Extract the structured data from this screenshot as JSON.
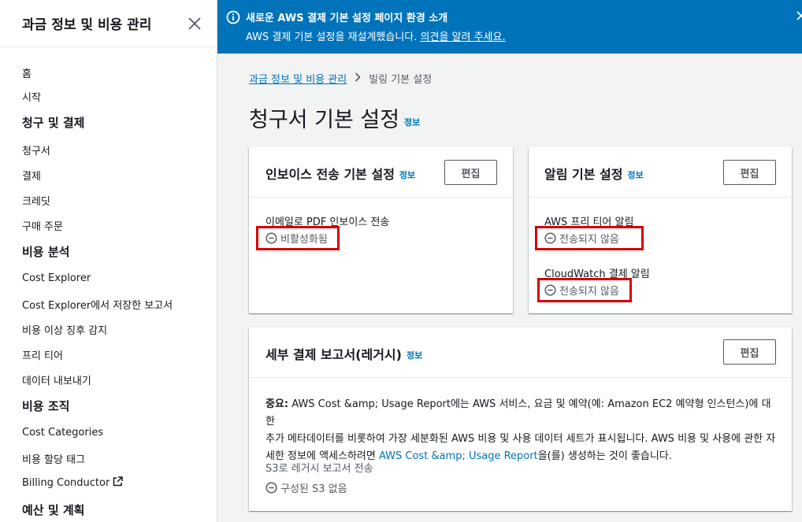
{
  "sidebar": {
    "title": "과금 정보 및 비용 관리",
    "items": [
      {
        "label": "홈"
      },
      {
        "label": "시작"
      },
      {
        "label": "청구 및 결제"
      },
      {
        "label": "청구서"
      },
      {
        "label": "결제"
      },
      {
        "label": "크레딧"
      },
      {
        "label": "구매 주문"
      },
      {
        "label": "비용 분석"
      },
      {
        "label": "Cost Explorer"
      },
      {
        "label": "Cost Explorer에서 저장한 보고서"
      },
      {
        "label": "비용 이상 징후 감지"
      },
      {
        "label": "프리 티어"
      },
      {
        "label": "데이터 내보내기"
      },
      {
        "label": "비용 조직"
      },
      {
        "label": "Cost Categories"
      },
      {
        "label": "비용 할당 태그"
      },
      {
        "label": "Billing Conductor"
      },
      {
        "label": "예산 및 계획"
      }
    ]
  },
  "banner": {
    "title": "새로운 AWS 결제 기본 설정 페이지 환경 소개",
    "text": "AWS 결제 기본 설정을 재설계했습니다.",
    "link": "의견을 알려 주세요.",
    "color": "#0073bb"
  },
  "breadcrumb": {
    "parent": "과금 정보 및 비용 관리",
    "current": "빌링 기본 설정"
  },
  "page": {
    "title": "청구서 기본 설정",
    "info": "정보"
  },
  "invoice_card": {
    "title": "인보이스 전송 기본 설정",
    "info": "정보",
    "edit": "편집",
    "field_label": "이메일로 PDF 인보이스 전송",
    "status": "비활성화됨"
  },
  "alert_card": {
    "title": "알림 기본 설정",
    "info": "정보",
    "edit": "편집",
    "free_tier_label": "AWS 프리 티어 알림",
    "free_tier_status": "전송되지 않음",
    "cloudwatch_label": "CloudWatch 결제 알림",
    "cloudwatch_status": "전송되지 않음"
  },
  "detail_card": {
    "title": "세부 결제 보고서(레거시)",
    "info": "정보",
    "edit": "편집",
    "body_bold": "중요:",
    "body_line1": " AWS Cost &amp; Usage Report에는 AWS 서비스, 요금 및 예약(예: Amazon EC2 예약형 인스턴스)에 대한",
    "body_line2": "추가 메타데이터를 비롯하여 가장 세분화된 AWS 비용 및 사용 데이터 세트가 표시됩니다. AWS 비용 및 사용에 관한 자",
    "body_line3_pre": "세한 정보에 액세스하려면 ",
    "body_link": "AWS Cost &amp; Usage Report",
    "body_line3_post": "을(를) 생성하는 것이 좋습니다.",
    "s3_label": "S3로 레거시 보고서 전송",
    "s3_status": "구성된 S3 없음"
  }
}
